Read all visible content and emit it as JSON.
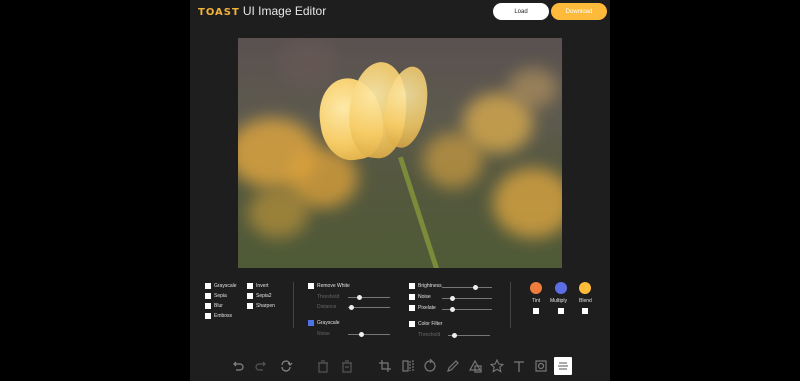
{
  "header": {
    "brand": "TOAST",
    "title": "UI Image Editor",
    "load_label": "Load",
    "download_label": "Download"
  },
  "filters": {
    "col1": [
      "Grayscale",
      "Sepia",
      "Blur",
      "Emboss"
    ],
    "col2": [
      "Invert",
      "Sepia2",
      "Sharpen"
    ],
    "remove_white": "Remove White",
    "threshold": "Threshold",
    "distance": "Distance",
    "grayscale2": "Grayscale",
    "noise_label": "Noise",
    "brightness": "Brightness",
    "noise": "Noise",
    "pixelate": "Pixelate",
    "color_filter": "Color Filter",
    "threshold2": "Threshold"
  },
  "colors": {
    "tint": {
      "label": "Tint",
      "color": "#f07d3c"
    },
    "multiply": {
      "label": "Multiply",
      "color": "#5b6ee6"
    },
    "blend": {
      "label": "Blend",
      "color": "#fdba3b"
    }
  },
  "toolbar": {
    "icons": [
      "undo-icon",
      "redo-icon",
      "reset-icon",
      "delete-icon",
      "delete-all-icon",
      "crop-icon",
      "flip-icon",
      "rotate-icon",
      "draw-icon",
      "shape-icon",
      "icon-icon",
      "text-icon",
      "mask-icon",
      "filter-icon"
    ]
  }
}
